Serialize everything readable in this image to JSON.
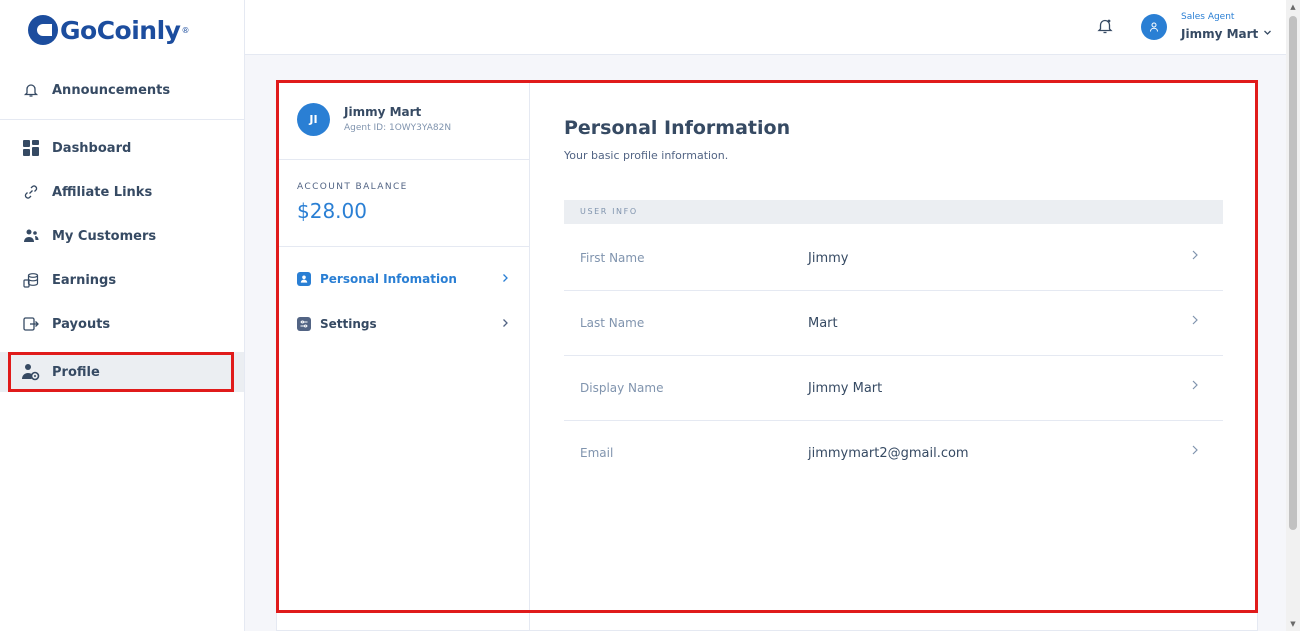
{
  "brand": {
    "logo_text": "GoCoinly",
    "reg": "®",
    "color": "#1c4d9e"
  },
  "sidebar": {
    "items": [
      {
        "label": "Announcements",
        "icon": "bell-icon"
      },
      {
        "label": "Dashboard",
        "icon": "grid-icon"
      },
      {
        "label": "Affiliate Links",
        "icon": "link-icon"
      },
      {
        "label": "My Customers",
        "icon": "users-icon"
      },
      {
        "label": "Earnings",
        "icon": "coins-icon"
      },
      {
        "label": "Payouts",
        "icon": "exit-icon"
      },
      {
        "label": "Profile",
        "icon": "user-gear-icon",
        "active": true
      }
    ]
  },
  "header": {
    "role": "Sales Agent",
    "user_name": "Jimmy Mart",
    "accent": "#2a7fd4"
  },
  "profile_card": {
    "user": {
      "initials": "JI",
      "name": "Jimmy Mart",
      "agent_id": "Agent ID: 1OWY3YA82N"
    },
    "balance": {
      "label": "ACCOUNT BALANCE",
      "value": "$28.00"
    },
    "menu": [
      {
        "label": "Personal Infomation",
        "icon": "user-card-icon",
        "active": true
      },
      {
        "label": "Settings",
        "icon": "settings-icon",
        "active": false
      }
    ]
  },
  "personal_info": {
    "title": "Personal Information",
    "subtitle": "Your basic profile information.",
    "section": "USER INFO",
    "rows": [
      {
        "label": "First Name",
        "value": "Jimmy"
      },
      {
        "label": "Last Name",
        "value": "Mart"
      },
      {
        "label": "Display Name",
        "value": "Jimmy Mart"
      },
      {
        "label": "Email",
        "value": "jimmymart2@gmail.com"
      }
    ]
  },
  "colors": {
    "highlight": "#e01b1b",
    "text": "#364a63",
    "muted": "#8094ae"
  }
}
